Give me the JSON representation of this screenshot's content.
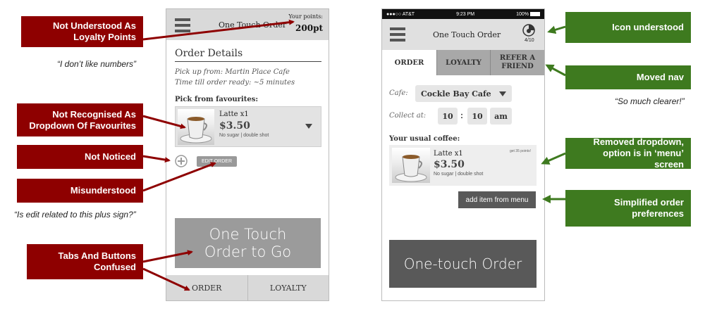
{
  "left_callouts": [
    {
      "text": "Not Understood As Loyalty Points"
    },
    {
      "text": "Not Recognised As Dropdown Of Favourites"
    },
    {
      "text": "Not Noticed"
    },
    {
      "text": "Misunderstood"
    },
    {
      "text": "Tabs And Buttons Confused"
    }
  ],
  "left_quotes": [
    "“I don’t like numbers”",
    "“Is edit related to this plus sign?”"
  ],
  "right_callouts": [
    {
      "text": "Icon understood"
    },
    {
      "text": "Moved nav"
    },
    {
      "text": "Removed dropdown, option is in ‘menu’ screen"
    },
    {
      "text": "Simplified order preferences"
    }
  ],
  "right_quotes": [
    "“So much clearer!”"
  ],
  "phone1": {
    "title": "One Touch Order",
    "points_label": "Your points:",
    "points_value": "200pt",
    "section_title": "Order Details",
    "pickup": "Pick up from: Martin Place Cafe",
    "time_till": "Time till order ready: ~5 minutes",
    "favourites_label": "Pick from favourites:",
    "item_name": "Latte x1",
    "item_price": "$3.50",
    "item_options": "No sugar | double shot",
    "edit_order": "EDIT ORDER",
    "cta": "One Touch Order to Go",
    "tabs": [
      "ORDER",
      "LOYALTY"
    ]
  },
  "phone2": {
    "status_carrier": "●●●○○ AT&T",
    "status_time": "9:23 PM",
    "status_battery": "100%",
    "title": "One Touch Order",
    "loyalty_count": "4/10",
    "tabs": [
      "ORDER",
      "LOYALTY",
      "REFER A FRIEND"
    ],
    "cafe_label": "Cafe:",
    "cafe_value": "Cockle Bay Cafe",
    "collect_label": "Collect at:",
    "hour": "10",
    "colon": ":",
    "minute": "10",
    "ampm": "am",
    "usual_label": "Your usual coffee:",
    "item_name": "Latte x1",
    "item_price": "$3.50",
    "item_options": "No sugar | double shot",
    "item_points": "get 35 points!",
    "add_item": "add item from menu",
    "cta": "One-touch Order"
  },
  "colors": {
    "red": "#8e0000",
    "green": "#3e7a1f",
    "grey_button": "#9b9b9b",
    "dark_button": "#595959"
  },
  "icons": [
    "hamburger-icon",
    "dropdown-arrow-icon",
    "plus-circle-icon",
    "loyalty-cup-icon",
    "arrow-icon"
  ]
}
